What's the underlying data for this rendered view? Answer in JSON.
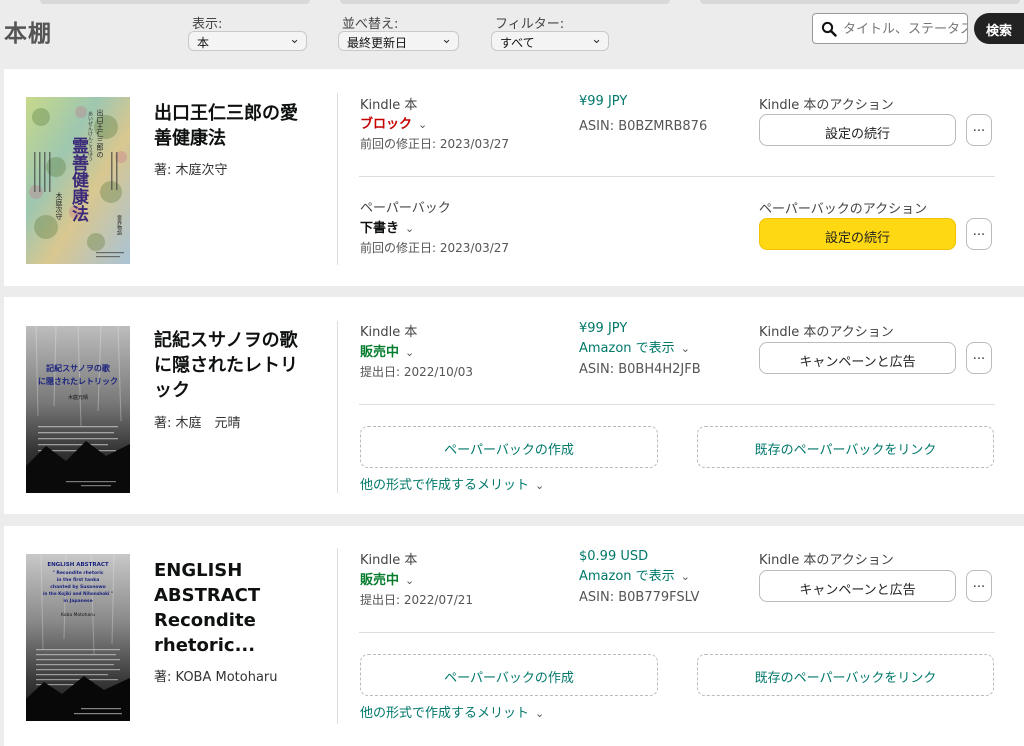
{
  "header": {
    "title": "本棚",
    "display_label": "表示:",
    "display_value": "本",
    "sort_label": "並べ替え:",
    "sort_value": "最終更新日",
    "filter_label": "フィルター:",
    "filter_value": "すべて",
    "search_placeholder": "タイトル、ステータス",
    "search_button": "検索"
  },
  "books": [
    {
      "title_lines": [
        "出口王仁三郎の愛",
        "善健康法"
      ],
      "author": "著: 木庭次守",
      "kindle": {
        "label": "Kindle 本",
        "status": "ブロック",
        "meta": "前回の修正日: 2023/03/27",
        "price": "¥99 JPY",
        "asin": "ASIN: B0BZMRB876",
        "action_label": "Kindle 本のアクション",
        "action_button": "設定の続行",
        "more": "..."
      },
      "paperback": {
        "label": "ペーパーバック",
        "status": "下書き",
        "meta": "前回の修正日: 2023/03/27",
        "action_label": "ペーパーバックのアクション",
        "action_button": "設定の続行",
        "more": "..."
      },
      "cover": {
        "title": "霊善健康法",
        "top": "出口王仁三郎の",
        "ruby": "あいぜんけんこうほう",
        "author": "木庭次守",
        "tag": "霊界物語"
      }
    },
    {
      "title_lines": [
        "記紀スサノヲの歌",
        "に隠されたレトリ",
        "ック"
      ],
      "author": "著: 木庭　元晴",
      "kindle": {
        "label": "Kindle 本",
        "status": "販売中",
        "meta": "提出日: 2022/10/03",
        "price": "¥99 JPY",
        "amazon_link": "Amazon で表示",
        "asin": "ASIN: B0BH4H2JFB",
        "action_label": "Kindle 本のアクション",
        "action_button": "キャンペーンと広告",
        "more": "..."
      },
      "create_paperback": "ペーパーバックの作成",
      "link_paperback": "既存のペーパーバックをリンク",
      "benefit_link": "他の形式で作成するメリット",
      "cover": {
        "title_line1": "記紀スサノヲの歌",
        "title_line2": "に隠されたレトリック",
        "author": "木庭元晴"
      }
    },
    {
      "title_lines": [
        "ENGLISH",
        "ABSTRACT",
        "Recondite",
        "rhetoric..."
      ],
      "author": "著: KOBA Motoharu",
      "kindle": {
        "label": "Kindle 本",
        "status": "販売中",
        "meta": "提出日: 2022/07/21",
        "price": "$0.99 USD",
        "amazon_link": "Amazon で表示",
        "asin": "ASIN: B0B779FSLV",
        "action_label": "Kindle 本のアクション",
        "action_button": "キャンペーンと広告",
        "more": "..."
      },
      "create_paperback": "ペーパーバックの作成",
      "link_paperback": "既存のペーパーバックをリンク",
      "benefit_link": "他の形式で作成するメリット",
      "cover": {
        "line1": "ENGLISH ABSTRACT",
        "line2": "\" Recondite rhetoric",
        "line3": "in the first tanka",
        "line4": "chanted by Susanowo",
        "line5": "in the Kojiki and Nihonshoki \"",
        "line6": "in Japanese",
        "author": "Koba Motoharu"
      }
    }
  ]
}
